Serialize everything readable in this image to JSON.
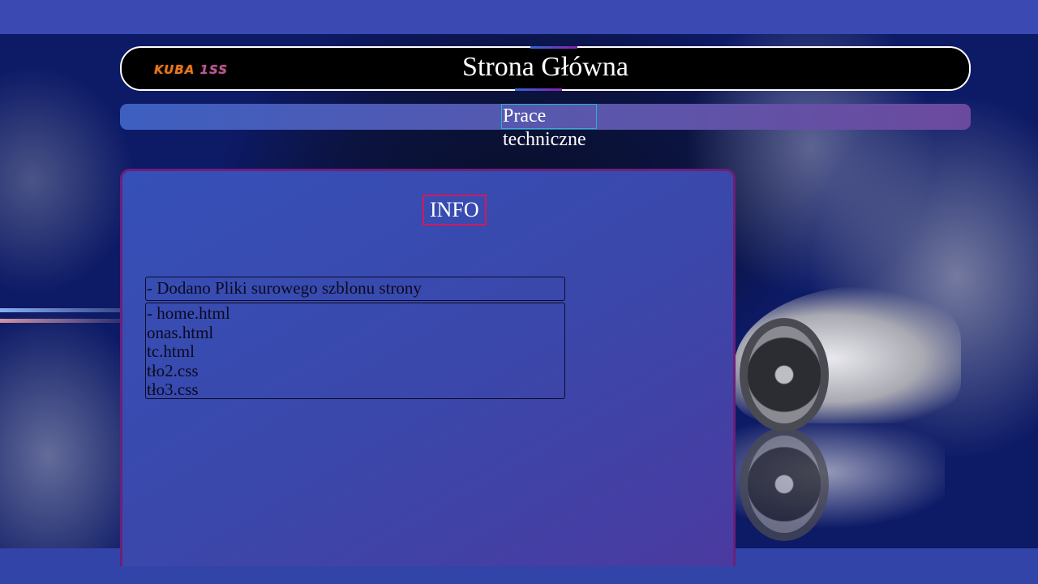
{
  "header": {
    "logo_text": "KUBA",
    "logo_tail": " 1SS",
    "title": "Strona Główna"
  },
  "nav": {
    "items": [
      {
        "label": "Prace techniczne"
      }
    ]
  },
  "panel": {
    "heading": "INFO",
    "note": "- Dodano Pliki surowego szblonu strony",
    "files": [
      "- home.html",
      "onas.html",
      "tc.html",
      "tło2.css",
      "tło3.css"
    ]
  },
  "colors": {
    "page_band": "#3a4ab2",
    "header_bg": "#000000",
    "nav_border": "#21b7c9",
    "info_border": "#d01a5e",
    "panel_border": "#6d1f7a"
  }
}
